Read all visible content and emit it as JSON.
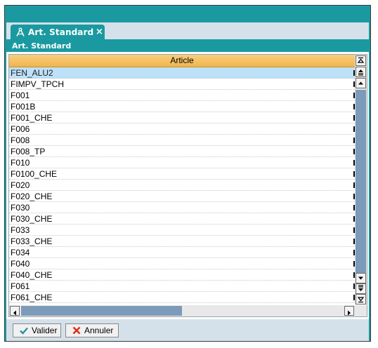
{
  "tab": {
    "label": "Art. Standard",
    "close_glyph": "×",
    "icon": "compass-icon"
  },
  "subtitle": "Art. Standard",
  "grid": {
    "column_header": "Article",
    "rows": [
      "FEN_ALU2",
      "FIMPV_TPCH",
      "F001",
      "F001B",
      "F001_CHE",
      "F006",
      "F008",
      "F008_TP",
      "F010",
      "F0100_CHE",
      "F020",
      "F020_CHE",
      "F030",
      "F030_CHE",
      "F033",
      "F033_CHE",
      "F034",
      "F040",
      "F040_CHE",
      "F061",
      "F061_CHE"
    ],
    "selected_index": 0
  },
  "buttons": {
    "validate": {
      "label": "Valider",
      "icon": "check-icon",
      "color": "#2f8fa0"
    },
    "cancel": {
      "label": "Annuler",
      "icon": "x-icon",
      "color": "#e0301e"
    }
  },
  "colors": {
    "accent": "#1a9aa0",
    "header": "#f2b44c",
    "selection": "#bde1f8",
    "scroll_thumb": "#7b9bb9"
  }
}
